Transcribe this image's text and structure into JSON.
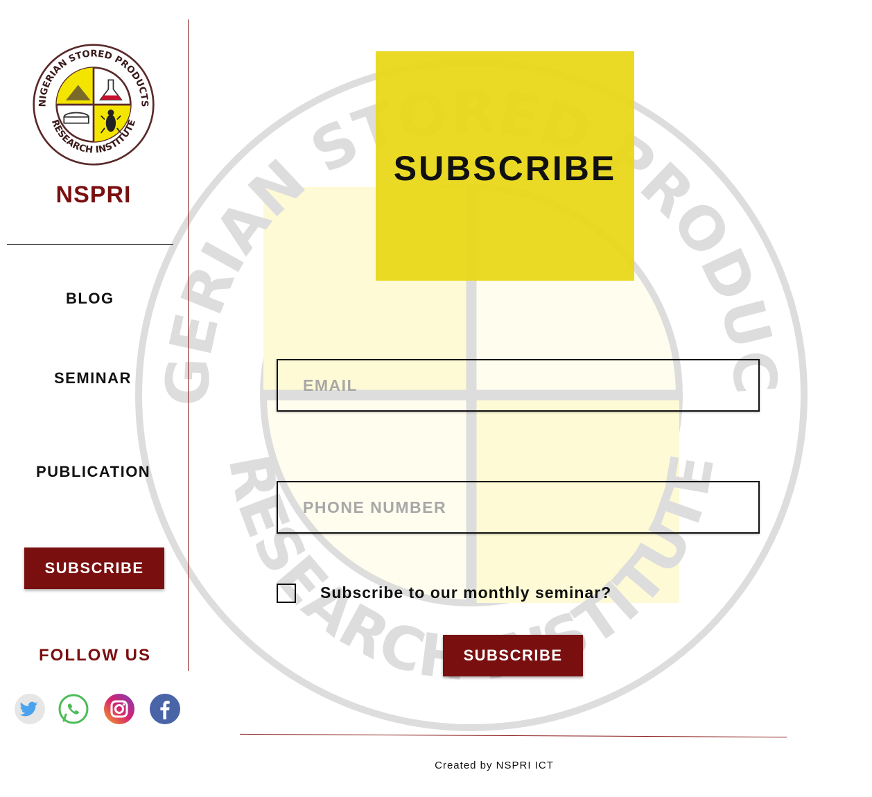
{
  "brand": {
    "logo_icon": "nspri-seal-logo",
    "logo_ring_text_top": "NIGERIAN STORED PRODUCTS",
    "logo_ring_text_bottom": "RESEARCH INSTITUTE",
    "name": "NSPRI"
  },
  "nav": {
    "items": [
      {
        "label": "BLOG"
      },
      {
        "label": "SEMINAR"
      },
      {
        "label": "PUBLICATION"
      }
    ],
    "subscribe_label": "SUBSCRIBE"
  },
  "follow": {
    "title": "FOLLOW US",
    "icons": [
      "twitter-icon",
      "whatsapp-icon",
      "instagram-icon",
      "facebook-icon"
    ]
  },
  "main": {
    "hero_title": "SUBSCRIBE",
    "email_placeholder": "EMAIL",
    "phone_placeholder": "PHONE NUMBER",
    "seminar_question": "Subscribe to our monthly seminar?",
    "seminar_checked": false,
    "submit_label": "SUBSCRIBE"
  },
  "footer": {
    "credit": "Created by NSPRI ICT"
  },
  "colors": {
    "brand_red": "#7a0f10",
    "hero_yellow": "#e8d714",
    "text": "#111111"
  }
}
